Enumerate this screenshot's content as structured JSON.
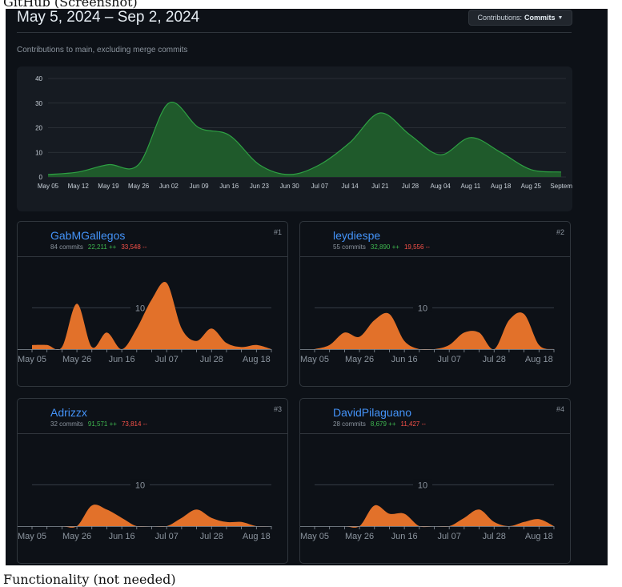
{
  "captions": {
    "top": "GitHub (Screenshot)",
    "bottom": "Functionality (not needed)"
  },
  "header": {
    "date_range": "May 5, 2024 – Sep 2, 2024",
    "contrib_button_prefix": "Contributions:",
    "contrib_button_value": "Commits",
    "subtitle": "Contributions to main, excluding merge commits"
  },
  "colors": {
    "main_area": "#1f5a2b",
    "main_stroke": "#2ea043",
    "user_area": "#e2712a",
    "bg": "#0d1117",
    "card": "#161b22",
    "link": "#4493f8",
    "add": "#3fb950",
    "del": "#f85149"
  },
  "chart_data": [
    {
      "type": "area",
      "title": "",
      "x": [
        "May 05",
        "May 12",
        "May 19",
        "May 26",
        "Jun 02",
        "Jun 09",
        "Jun 16",
        "Jun 23",
        "Jun 30",
        "Jul 07",
        "Jul 14",
        "Jul 21",
        "Jul 28",
        "Aug 04",
        "Aug 11",
        "Aug 18",
        "Aug 25",
        "September"
      ],
      "series": [
        {
          "values": [
            1,
            2,
            5,
            5,
            30,
            20,
            17,
            5,
            1,
            5,
            14,
            26,
            17,
            9,
            16,
            10,
            3,
            2
          ]
        }
      ],
      "ylim": [
        0,
        40
      ],
      "yticks": [
        0,
        10,
        20,
        30,
        40
      ],
      "grid": true
    },
    {
      "type": "area",
      "user": "GabMGallegos",
      "x": [
        "May 05",
        "May 12",
        "May 19",
        "May 26",
        "Jun 02",
        "Jun 09",
        "Jun 16",
        "Jun 23",
        "Jun 30",
        "Jul 07",
        "Jul 14",
        "Jul 21",
        "Jul 28",
        "Aug 04",
        "Aug 11",
        "Aug 18",
        "Aug 25"
      ],
      "series": [
        {
          "values": [
            1,
            1,
            0.5,
            11,
            0.5,
            4,
            0,
            5,
            12,
            16,
            5,
            2,
            5,
            1.5,
            0.5,
            1,
            0
          ]
        }
      ],
      "xticks": [
        "May 05",
        "May 26",
        "Jun 16",
        "Jul 07",
        "Jul 28",
        "Aug 18"
      ],
      "ylim": [
        0,
        18
      ],
      "ytick": 10
    },
    {
      "type": "area",
      "user": "leydiespe",
      "x": [
        "May 05",
        "May 12",
        "May 19",
        "May 26",
        "Jun 02",
        "Jun 09",
        "Jun 16",
        "Jun 23",
        "Jun 30",
        "Jul 07",
        "Jul 14",
        "Jul 21",
        "Jul 28",
        "Aug 04",
        "Aug 11",
        "Aug 18",
        "Aug 25"
      ],
      "series": [
        {
          "values": [
            0,
            1,
            4,
            3,
            7,
            8.5,
            2,
            0,
            0,
            1,
            4,
            4,
            0,
            7,
            8.5,
            1,
            0
          ]
        }
      ],
      "xticks": [
        "May 05",
        "May 26",
        "Jun 16",
        "Jul 07",
        "Jul 28",
        "Aug 18"
      ],
      "ylim": [
        0,
        18
      ],
      "ytick": 10
    },
    {
      "type": "area",
      "user": "Adrizzx",
      "x": [
        "May 05",
        "May 12",
        "May 19",
        "May 26",
        "Jun 02",
        "Jun 09",
        "Jun 16",
        "Jun 23",
        "Jun 30",
        "Jul 07",
        "Jul 14",
        "Jul 21",
        "Jul 28",
        "Aug 04",
        "Aug 11",
        "Aug 18",
        "Aug 25"
      ],
      "series": [
        {
          "values": [
            0,
            0,
            0,
            0,
            5,
            4,
            2,
            0,
            0,
            0,
            2,
            4,
            2,
            1,
            1,
            0,
            0
          ]
        }
      ],
      "xticks": [
        "May 05",
        "May 26",
        "Jun 16",
        "Jul 07",
        "Jul 28",
        "Aug 18"
      ],
      "ylim": [
        0,
        18
      ],
      "ytick": 10
    },
    {
      "type": "area",
      "user": "DavidPilaguano",
      "x": [
        "May 05",
        "May 12",
        "May 19",
        "May 26",
        "Jun 02",
        "Jun 09",
        "Jun 16",
        "Jun 23",
        "Jun 30",
        "Jul 07",
        "Jul 14",
        "Jul 21",
        "Jul 28",
        "Aug 04",
        "Aug 11",
        "Aug 18",
        "Aug 25"
      ],
      "series": [
        {
          "values": [
            0,
            0,
            0,
            0,
            5,
            3,
            3,
            0,
            0,
            0,
            2,
            4,
            1,
            0,
            1,
            1.7,
            0
          ]
        }
      ],
      "xticks": [
        "May 05",
        "May 26",
        "Jun 16",
        "Jul 07",
        "Jul 28",
        "Aug 18"
      ],
      "ylim": [
        0,
        18
      ],
      "ytick": 10
    }
  ],
  "contributors": [
    {
      "name": "GabMGallegos",
      "commits": "84 commits",
      "additions": "22,211 ++",
      "deletions": "33,548 --",
      "rank": "#1"
    },
    {
      "name": "leydiespe",
      "commits": "55 commits",
      "additions": "32,890 ++",
      "deletions": "19,556 --",
      "rank": "#2"
    },
    {
      "name": "Adrizzx",
      "commits": "32 commits",
      "additions": "91,571 ++",
      "deletions": "73,814 --",
      "rank": "#3"
    },
    {
      "name": "DavidPilaguano",
      "commits": "28 commits",
      "additions": "8,679 ++",
      "deletions": "11,427 --",
      "rank": "#4"
    }
  ]
}
